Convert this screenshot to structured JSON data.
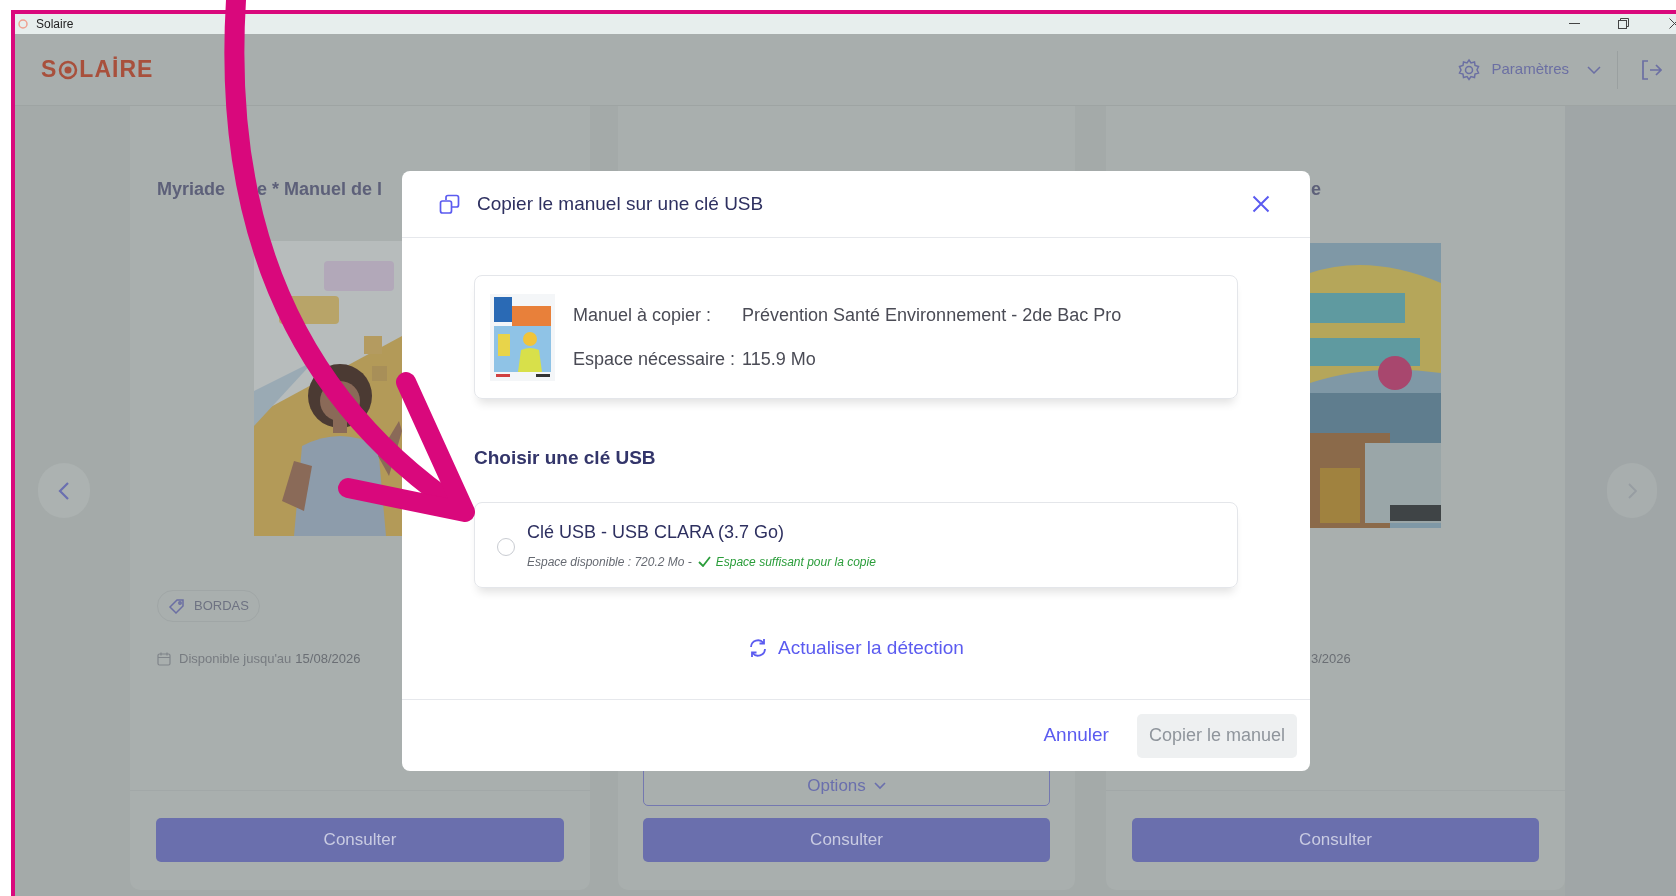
{
  "title_bar": {
    "title": "Solaire"
  },
  "header": {
    "logo": {
      "start": "S",
      "end": "LAİRE"
    },
    "settings_label": "Paramètres"
  },
  "cards": [
    {
      "title_parts": [
        "Myriade",
        "e * Manuel de l"
      ],
      "publisher": "BORDAS",
      "availability_label": "Disponible jusqu'au",
      "availability_date": "15/08/2026",
      "button": "Consulter"
    },
    {
      "options_label": "Options",
      "button": "Consulter"
    },
    {
      "title_parts": [
        "e"
      ],
      "availability_date": "3/2026",
      "button": "Consulter"
    }
  ],
  "dialog": {
    "title": "Copier le manuel sur une clé USB",
    "manual_rows": [
      {
        "label": "Manuel à copier :",
        "value": "Prévention Santé Environnement - 2de Bac Pro"
      },
      {
        "label": "Espace nécessaire :",
        "value": "115.9 Mo"
      }
    ],
    "section_title": "Choisir une clé USB",
    "drives": [
      {
        "name": "Clé USB - USB CLARA (3.7 Go)",
        "available": "Espace disponible : 720.2 Mo -",
        "space_ok": true,
        "space_message": "Espace suffisant pour la copie",
        "selected": false
      }
    ],
    "refresh_label": "Actualiser la détection",
    "cancel_label": "Annuler",
    "confirm": {
      "label": "Copier le manuel",
      "disabled": true
    }
  }
}
